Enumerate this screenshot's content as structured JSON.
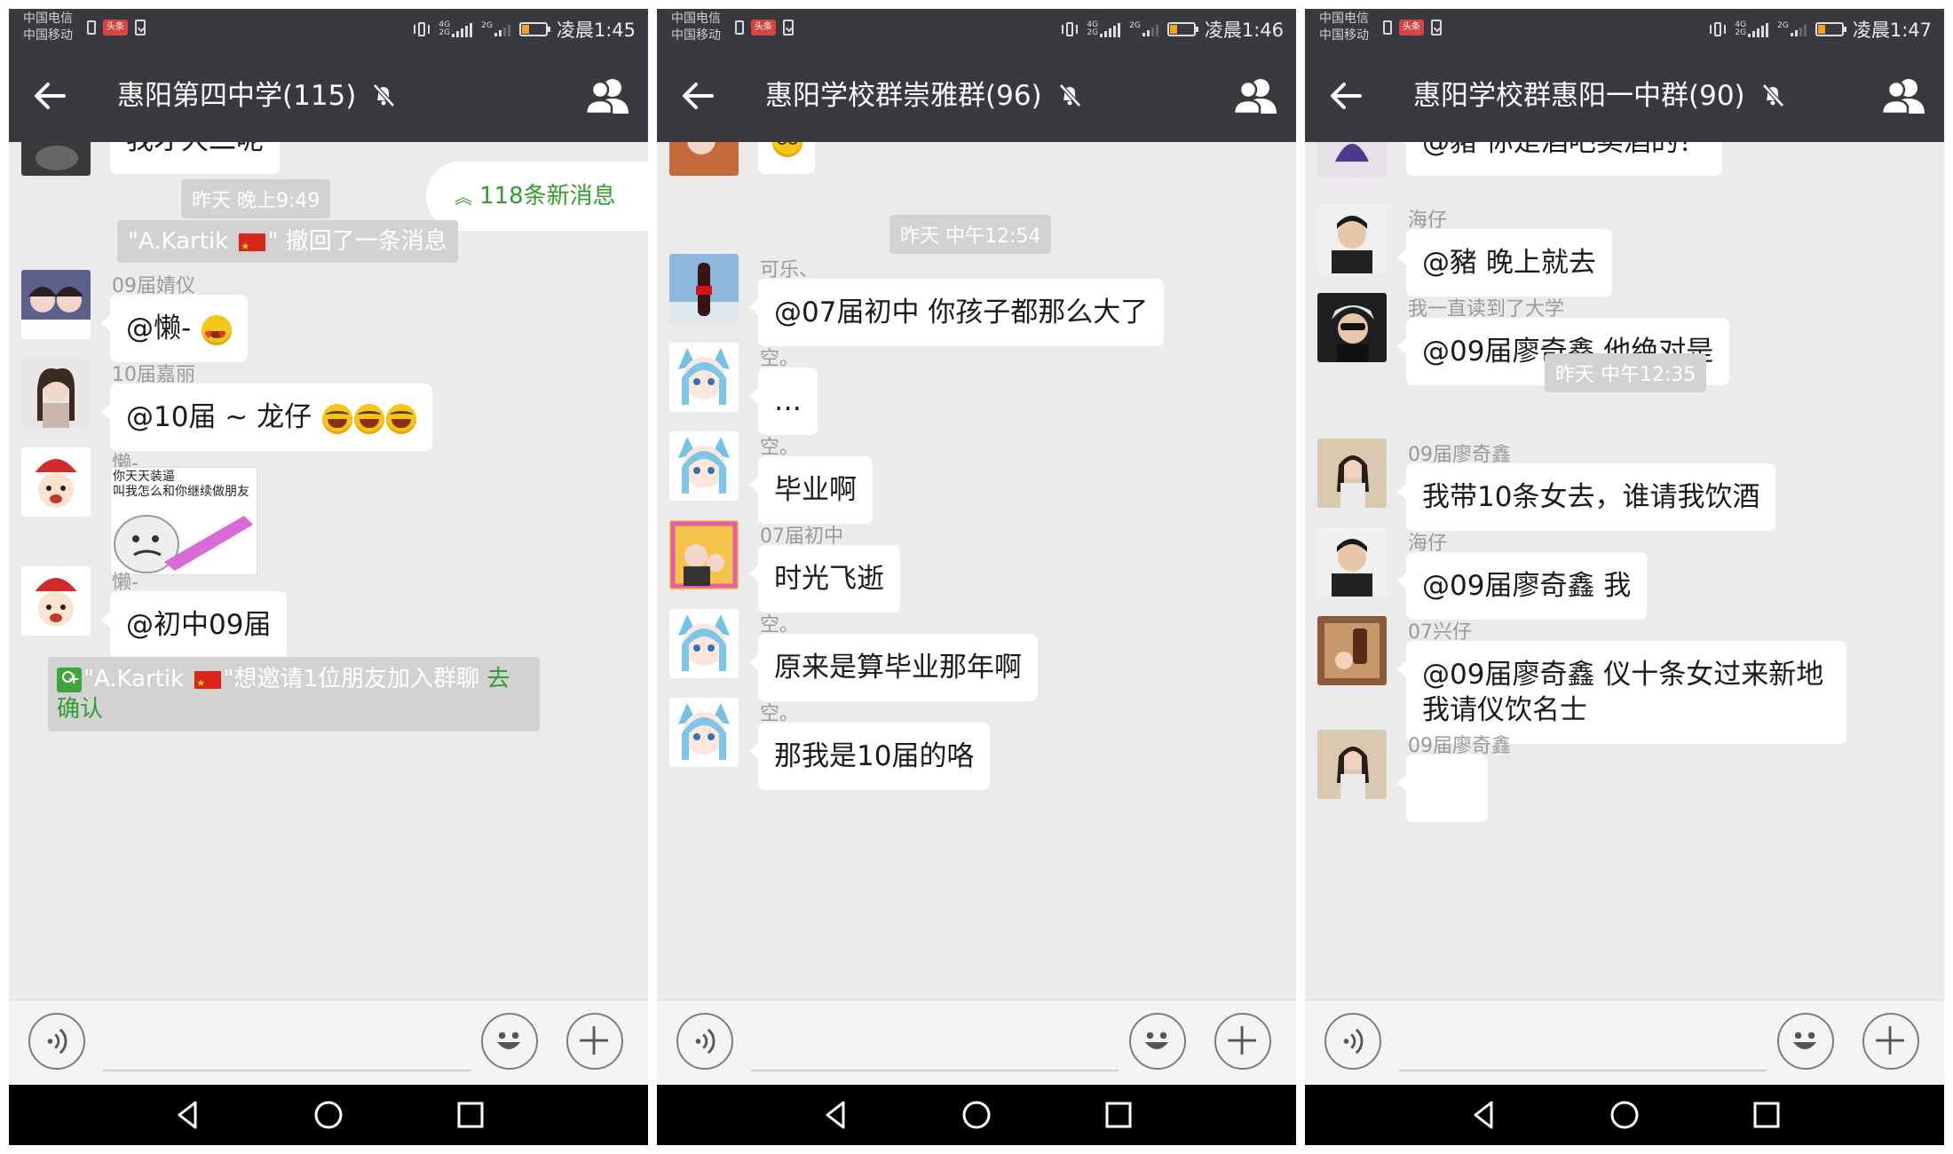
{
  "panels": [
    {
      "status": {
        "carrier_1": "中国电信",
        "carrier_2": "中国移动",
        "badge": "头条",
        "net": "4G",
        "net2": "2G",
        "sim2": "2G",
        "time": "凌晨1:45"
      },
      "title": "惠阳第四中学(115)",
      "new_messages": "118条新消息",
      "messages": [
        {
          "text": "我才大二呢"
        },
        {
          "time": "昨天 晚上9:49"
        },
        {
          "recall_pre": "\"A.Kartik ",
          "recall_post": "\" 撤回了一条消息"
        },
        {
          "sender": "09届婧仪",
          "text": "@懒- "
        },
        {
          "sender": "10届嘉丽",
          "text": "@10届 ~ 龙仔 "
        },
        {
          "sender": "懒-",
          "sticker_line1": "你天天装逼",
          "sticker_line2": "叫我怎么和你继续做朋友"
        },
        {
          "sender": "懒-",
          "text": "@初中09届"
        },
        {
          "invite_pre": "\"A.Kartik ",
          "invite_mid": "\"想邀请1位朋友加入群聊  ",
          "invite_link": "去确认"
        }
      ]
    },
    {
      "status": {
        "carrier_1": "中国电信",
        "carrier_2": "中国移动",
        "badge": "头条",
        "net": "4G",
        "net2": "2G",
        "sim2": "2G",
        "time": "凌晨1:46"
      },
      "title": "惠阳学校群崇雅群(96)",
      "messages": [
        {
          "time": "昨天 中午12:54"
        },
        {
          "sender": "可乐、",
          "text": "@07届初中 你孩子都那么大了"
        },
        {
          "sender": "空。",
          "text": "…"
        },
        {
          "sender": "空。",
          "text": "毕业啊"
        },
        {
          "sender": "07届初中",
          "text": "时光飞逝"
        },
        {
          "sender": "空。",
          "text": "原来是算毕业那年啊"
        },
        {
          "sender": "空。",
          "text": "那我是10届的咯"
        }
      ]
    },
    {
      "status": {
        "carrier_1": "中国电信",
        "carrier_2": "中国移动",
        "badge": "头条",
        "net": "4G",
        "net2": "2G",
        "sim2": "2G",
        "time": "凌晨1:47"
      },
      "title": "惠阳学校群惠阳一中群(90)",
      "messages": [
        {
          "text": "@豬 你是酒吧卖酒的？"
        },
        {
          "sender": "海仔",
          "text": "@豬 晚上就去"
        },
        {
          "sender": "我一直读到了大学",
          "text": "@09届廖奇鑫 他绝对是"
        },
        {
          "time": "昨天 中午12:35"
        },
        {
          "sender": "09届廖奇鑫",
          "text": "我带10条女去，谁请我饮酒"
        },
        {
          "sender": "海仔",
          "text": "@09届廖奇鑫 我"
        },
        {
          "sender": "07兴仔",
          "text": "@09届廖奇鑫 仪十条女过来新地我请仪饮名士"
        },
        {
          "sender": "09届廖奇鑫"
        }
      ]
    }
  ],
  "colors": {
    "title_bar": "#393a3f",
    "chat_bg": "#ebebeb",
    "accent_green": "#2e9e2e",
    "bubble": "#ffffff"
  },
  "icons": [
    "back-arrow-icon",
    "mute-icon",
    "members-icon",
    "voice-icon",
    "emoji-icon",
    "plus-icon",
    "nav-back-icon",
    "nav-home-icon",
    "nav-recent-icon"
  ]
}
